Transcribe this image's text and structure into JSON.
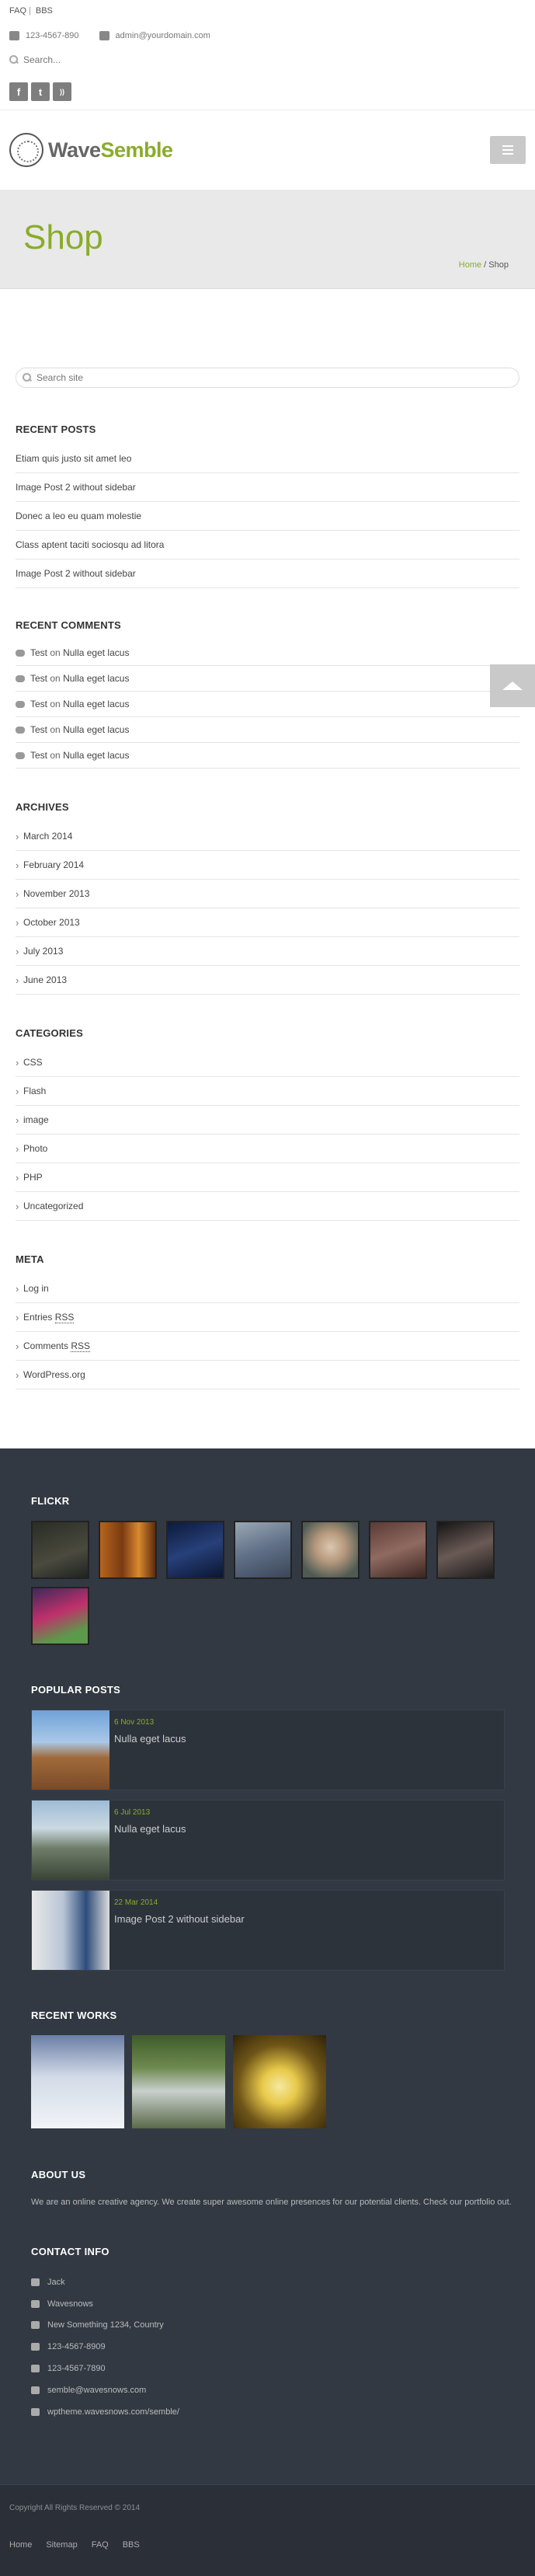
{
  "topbar": {
    "links": [
      "FAQ",
      "BBS"
    ],
    "phone": "123-4567-890",
    "email": "admin@yourdomain.com",
    "search_placeholder": "Search...",
    "socials": [
      "f",
      "t",
      "rss"
    ]
  },
  "header": {
    "logo_part1": "Wave",
    "logo_part2": "Semble"
  },
  "page_title": {
    "title": "Shop",
    "breadcrumb_home": "Home",
    "breadcrumb_sep": " / ",
    "breadcrumb_current": "Shop"
  },
  "sidebar": {
    "search_placeholder": "Search site",
    "recent_posts": {
      "title": "RECENT POSTS",
      "items": [
        "Etiam quis justo sit amet leo",
        "Image Post 2 without sidebar",
        "Donec a leo eu quam molestie",
        "Class aptent taciti sociosqu ad litora",
        "Image Post 2 without sidebar"
      ]
    },
    "recent_comments": {
      "title": "RECENT COMMENTS",
      "items": [
        {
          "author": "Test",
          "on": "on",
          "post": "Nulla eget lacus"
        },
        {
          "author": "Test",
          "on": "on",
          "post": "Nulla eget lacus"
        },
        {
          "author": "Test",
          "on": "on",
          "post": "Nulla eget lacus"
        },
        {
          "author": "Test",
          "on": "on",
          "post": "Nulla eget lacus"
        },
        {
          "author": "Test",
          "on": "on",
          "post": "Nulla eget lacus"
        }
      ]
    },
    "archives": {
      "title": "ARCHIVES",
      "items": [
        "March 2014",
        "February 2014",
        "November 2013",
        "October 2013",
        "July 2013",
        "June 2013"
      ]
    },
    "categories": {
      "title": "CATEGORIES",
      "items": [
        "CSS",
        "Flash",
        "image",
        "Photo",
        "PHP",
        "Uncategorized"
      ]
    },
    "meta": {
      "title": "META",
      "login": "Log in",
      "entries": "Entries",
      "comments": "Comments",
      "rss": "RSS",
      "wordpress": "WordPress.org"
    }
  },
  "footer": {
    "flickr_title": "FLICKR",
    "popular_title": "POPULAR POSTS",
    "popular_posts": [
      {
        "date": "6 Nov 2013",
        "title": "Nulla eget lacus"
      },
      {
        "date": "6 Jul 2013",
        "title": "Nulla eget lacus"
      },
      {
        "date": "22 Mar 2014",
        "title": "Image Post 2 without sidebar"
      }
    ],
    "works_title": "RECENT WORKS",
    "about_title": "ABOUT US",
    "about_text": "We are an online creative agency. We create super awesome online presences for our potential clients. Check our portfolio out.",
    "contact_title": "CONTACT INFO",
    "contact": [
      {
        "icon": "user-icon",
        "text": "Jack"
      },
      {
        "icon": "folder-icon",
        "text": "Wavesnows"
      },
      {
        "icon": "home-icon",
        "text": "New Something 1234, Country"
      },
      {
        "icon": "phone-icon",
        "text": "123-4567-8909"
      },
      {
        "icon": "print-icon",
        "text": "123-4567-7890"
      },
      {
        "icon": "envelope-icon",
        "text": "semble@wavesnows.com"
      },
      {
        "icon": "globe-icon",
        "text": "wptheme.wavesnows.com/semble/"
      }
    ]
  },
  "bottom": {
    "copyright": "Copyright All Rights Reserved © 2014",
    "links": [
      "Home",
      "Sitemap",
      "FAQ",
      "BBS"
    ]
  }
}
